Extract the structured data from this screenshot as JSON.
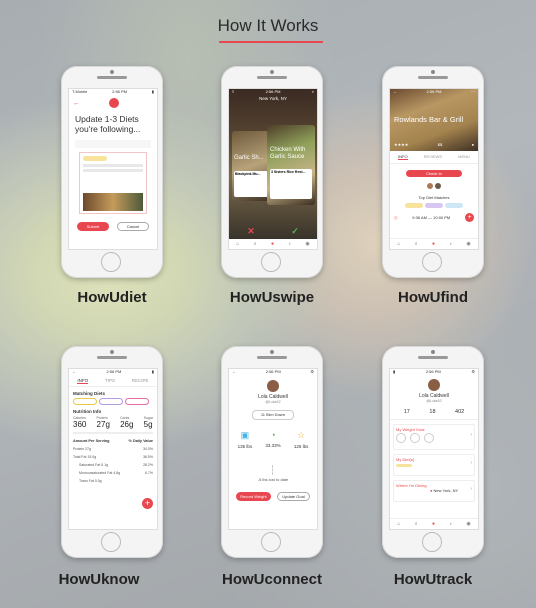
{
  "section_title": "How It Works",
  "accent": "#e8474f",
  "apps": [
    {
      "name": "HowUdiet"
    },
    {
      "name": "HowUswipe"
    },
    {
      "name": "HowUfind"
    },
    {
      "name": "HowUknow"
    },
    {
      "name": "HowUconnect"
    },
    {
      "name": "HowUtrack"
    }
  ],
  "diet_screen": {
    "status_carrier": "T-Mobile",
    "status_time": "2:56 PM",
    "heading": "Update 1-3 Diets you're following...",
    "submit": "Submit",
    "cancel": "Cancel"
  },
  "swipe_screen": {
    "status_time": "2:56 PM",
    "location": "New York, NY",
    "dish_back": "Garlic Sh...",
    "dish_front": "Chicken With Garlic Sauce",
    "card_left": "Blackpink Mu...",
    "card_right": "3 Sisters Rice Rest..."
  },
  "find_screen": {
    "status_time": "2:56 PM",
    "restaurant": "Rowlands Bar & Grill",
    "tab_info": "INFO",
    "tab_reviews": "REVIEWS",
    "tab_menu": "MENU",
    "action": "Check In",
    "top_diet_matches": "Top Diet Matches",
    "hours": "9:36 AM — 10:00 PM"
  },
  "know_screen": {
    "status_time": "2:56 PM",
    "tab_info": "INFO",
    "tab_tips": "TIPS",
    "tab_recipe": "RECIPE",
    "matching_diets": "Matching Diets",
    "nutrition_info": "Nutrition Info",
    "nutrients": [
      {
        "label": "Calories",
        "value": "360"
      },
      {
        "label": "Protein",
        "value": "27g"
      },
      {
        "label": "Carbs",
        "value": "26g"
      },
      {
        "label": "Sugar",
        "value": "5g"
      }
    ],
    "amount_per_serving": "Amount Per Serving",
    "daily_value": "% Daily Value",
    "rows": [
      {
        "label": "Protein 27g",
        "value": "34.0%"
      },
      {
        "label": "Total Fat 15.0g",
        "value": "36.5%"
      },
      {
        "label": "Saturated Fat 5.1g",
        "value": "28.2%"
      },
      {
        "label": "Monounsaturated Fat 4.8g",
        "value": "6.7%"
      },
      {
        "label": "Trans Fat 0.0g",
        "value": ""
      }
    ]
  },
  "connect_screen": {
    "status_time": "2:56 PM",
    "user": "Lola Caldwell",
    "handle": "@Lola92",
    "goal": "Slim Down",
    "stats": [
      {
        "value": "135 lbs"
      },
      {
        "value": "33.33%"
      },
      {
        "value": "125 lbs"
      }
    ],
    "lbs_left": "-5 lbs lost to date",
    "record_button": "Record Weight",
    "update_button": "Update Goal"
  },
  "track_screen": {
    "status_time": "2:56 PM",
    "user": "Lola Caldwell",
    "handle": "@Lola92",
    "counts": [
      {
        "value": "17"
      },
      {
        "value": "18"
      },
      {
        "value": "402"
      }
    ],
    "rows": [
      {
        "label": "My Weight Goal"
      },
      {
        "label": "My Diet(s)"
      },
      {
        "label": "Where I'm Dining",
        "value": "New York, NY"
      }
    ]
  }
}
